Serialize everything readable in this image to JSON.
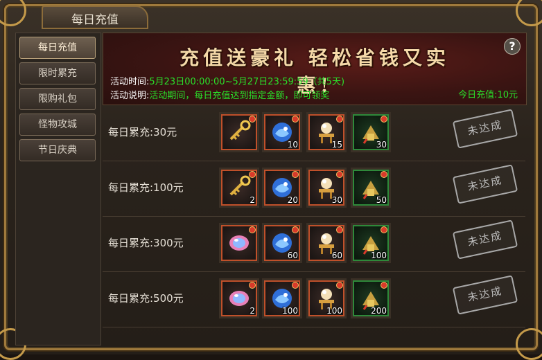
{
  "window": {
    "title": "每日充值"
  },
  "sidebar": {
    "items": [
      {
        "label": "每日充值",
        "active": true
      },
      {
        "label": "限时累充",
        "active": false
      },
      {
        "label": "限购礼包",
        "active": false
      },
      {
        "label": "怪物攻城",
        "active": false
      },
      {
        "label": "节日庆典",
        "active": false
      }
    ]
  },
  "banner": {
    "headline": "充值送豪礼 轻松省钱又实惠!",
    "help_label": "?",
    "time_label": "活动时间:",
    "time_value": "5月23日00:00:00~5月27日23:59:59（共5天)",
    "desc_label": "活动说明:",
    "desc_value": "活动期间，每日充值达到指定金额，即可领奖",
    "today": "今日充值:10元"
  },
  "rows": [
    {
      "label": "每日累充:30元",
      "status": "未达成",
      "items": [
        {
          "icon": "golden-key-icon",
          "qty": ""
        },
        {
          "icon": "blue-dragon-icon",
          "qty": "10"
        },
        {
          "icon": "pearl-altar-icon",
          "qty": "15"
        },
        {
          "icon": "jade-seal-icon",
          "qty": "30"
        }
      ]
    },
    {
      "label": "每日累充:100元",
      "status": "未达成",
      "items": [
        {
          "icon": "golden-key-icon",
          "qty": "2"
        },
        {
          "icon": "blue-dragon-icon",
          "qty": "20"
        },
        {
          "icon": "pearl-altar-icon",
          "qty": "30"
        },
        {
          "icon": "jade-seal-icon",
          "qty": "50"
        }
      ]
    },
    {
      "label": "每日累充:300元",
      "status": "未达成",
      "items": [
        {
          "icon": "rainbow-gem-icon",
          "qty": ""
        },
        {
          "icon": "blue-dragon-icon",
          "qty": "60"
        },
        {
          "icon": "pearl-altar-icon",
          "qty": "60"
        },
        {
          "icon": "jade-seal-icon",
          "qty": "100"
        }
      ]
    },
    {
      "label": "每日累充:500元",
      "status": "未达成",
      "items": [
        {
          "icon": "rainbow-gem-icon",
          "qty": "2"
        },
        {
          "icon": "blue-dragon-icon",
          "qty": "100"
        },
        {
          "icon": "pearl-altar-icon",
          "qty": "100"
        },
        {
          "icon": "jade-seal-icon",
          "qty": "200"
        }
      ]
    }
  ],
  "colors": {
    "accent_green": "#2ae02a",
    "gold": "#c49a4a",
    "banner_red": "#3a1412"
  }
}
